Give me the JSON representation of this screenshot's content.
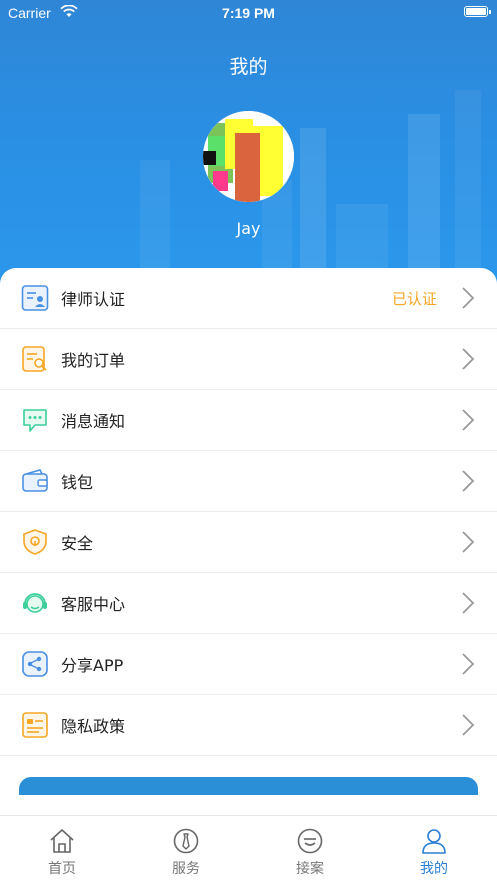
{
  "status_bar": {
    "carrier": "Carrier",
    "time": "7:19 PM"
  },
  "header": {
    "title": "我的",
    "username": "Jay"
  },
  "menu": [
    {
      "label": "律师认证",
      "status": "已认证",
      "icon": "lawyer-certify-icon",
      "color": "#4a90e2"
    },
    {
      "label": "我的订单",
      "status": "",
      "icon": "order-icon",
      "color": "#f5a623"
    },
    {
      "label": "消息通知",
      "status": "",
      "icon": "message-icon",
      "color": "#3ccf9a"
    },
    {
      "label": "钱包",
      "status": "",
      "icon": "wallet-icon",
      "color": "#4a90e2"
    },
    {
      "label": "安全",
      "status": "",
      "icon": "shield-icon",
      "color": "#f5a623"
    },
    {
      "label": "客服中心",
      "status": "",
      "icon": "headset-icon",
      "color": "#3ccf9a"
    },
    {
      "label": "分享APP",
      "status": "",
      "icon": "share-icon",
      "color": "#4a90e2"
    },
    {
      "label": "隐私政策",
      "status": "",
      "icon": "privacy-icon",
      "color": "#f5a623"
    }
  ],
  "tabbar": [
    {
      "label": "首页",
      "icon": "home-icon",
      "active": false
    },
    {
      "label": "服务",
      "icon": "tie-icon",
      "active": false
    },
    {
      "label": "接案",
      "icon": "case-icon",
      "active": false
    },
    {
      "label": "我的",
      "icon": "person-icon",
      "active": true
    }
  ],
  "colors": {
    "accent": "#2b7fd4",
    "verified": "#f5a623",
    "header": "#2a8fe3"
  }
}
